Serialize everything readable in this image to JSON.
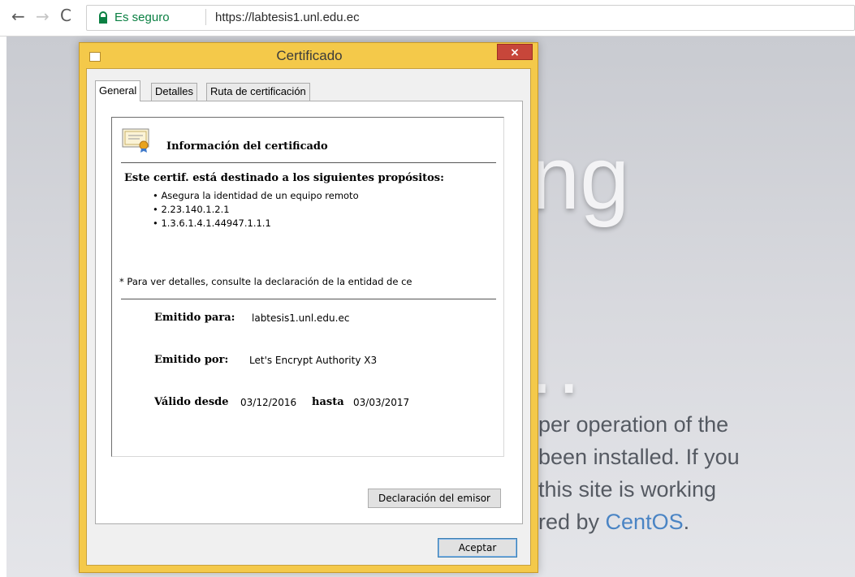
{
  "browser": {
    "secure_label": "Es seguro",
    "url": "https://labtesis1.unl.edu.ec",
    "nav": {
      "back": "←",
      "forward": "→",
      "reload": "C"
    }
  },
  "background_page": {
    "heading_fragment": "ng",
    "dots": "..",
    "paragraph_lines": [
      "per operation of the",
      "been installed. If you",
      "this site is working",
      "red by "
    ],
    "link_text": "CentOS",
    "link_suffix": ".",
    "link_color": "#4a84c4"
  },
  "dialog": {
    "title": "Certificado",
    "close_label": "×",
    "tabs": [
      {
        "label": "General",
        "active": true
      },
      {
        "label": "Detalles",
        "active": false
      },
      {
        "label": "Ruta de certificación",
        "active": false
      }
    ],
    "info_title": "Información del certificado",
    "purposes_title": "Este certif. está destinado a los siguientes propósitos:",
    "purposes": [
      "• Asegura la identidad de un equipo remoto",
      "• 2.23.140.1.2.1",
      "• 1.3.6.1.4.1.44947.1.1.1"
    ],
    "note": "* Para ver detalles, consulte la declaración de la entidad de ce",
    "issued_to_label": "Emitido para:",
    "issued_to_value": "labtesis1.unl.edu.ec",
    "issued_by_label": "Emitido por:",
    "issued_by_value": "Let's Encrypt Authority X3",
    "valid_from_label": "Válido desde",
    "valid_from_value": "03/12/2016",
    "valid_to_label": "hasta",
    "valid_to_value": "03/03/2017",
    "issuer_statement_button": "Declaración del emisor",
    "ok_button": "Aceptar",
    "colors": {
      "frame": "#f4c94a",
      "close": "#c7463a"
    }
  }
}
